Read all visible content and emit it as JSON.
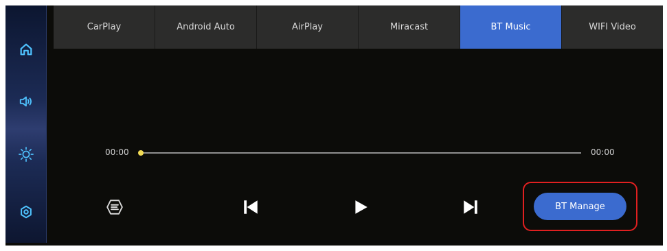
{
  "tabs": [
    {
      "label": "CarPlay",
      "active": false
    },
    {
      "label": "Android Auto",
      "active": false
    },
    {
      "label": "AirPlay",
      "active": false
    },
    {
      "label": "Miracast",
      "active": false
    },
    {
      "label": "BT Music",
      "active": true
    },
    {
      "label": "WIFI Video",
      "active": false
    }
  ],
  "sidebar": {
    "items": [
      {
        "icon": "home-icon"
      },
      {
        "icon": "volume-icon"
      },
      {
        "icon": "brightness-icon"
      },
      {
        "icon": "settings-icon"
      }
    ]
  },
  "player": {
    "current_time": "00:00",
    "total_time": "00:00",
    "progress": 0
  },
  "controls": {
    "playlist_icon": "playlist-icon",
    "previous_icon": "skip-previous-icon",
    "play_icon": "play-icon",
    "next_icon": "skip-next-icon",
    "bt_manage_label": "BT Manage"
  },
  "colors": {
    "accent": "#3b6bcf",
    "progress_knob": "#f2dc55",
    "highlight": "#e02020"
  }
}
